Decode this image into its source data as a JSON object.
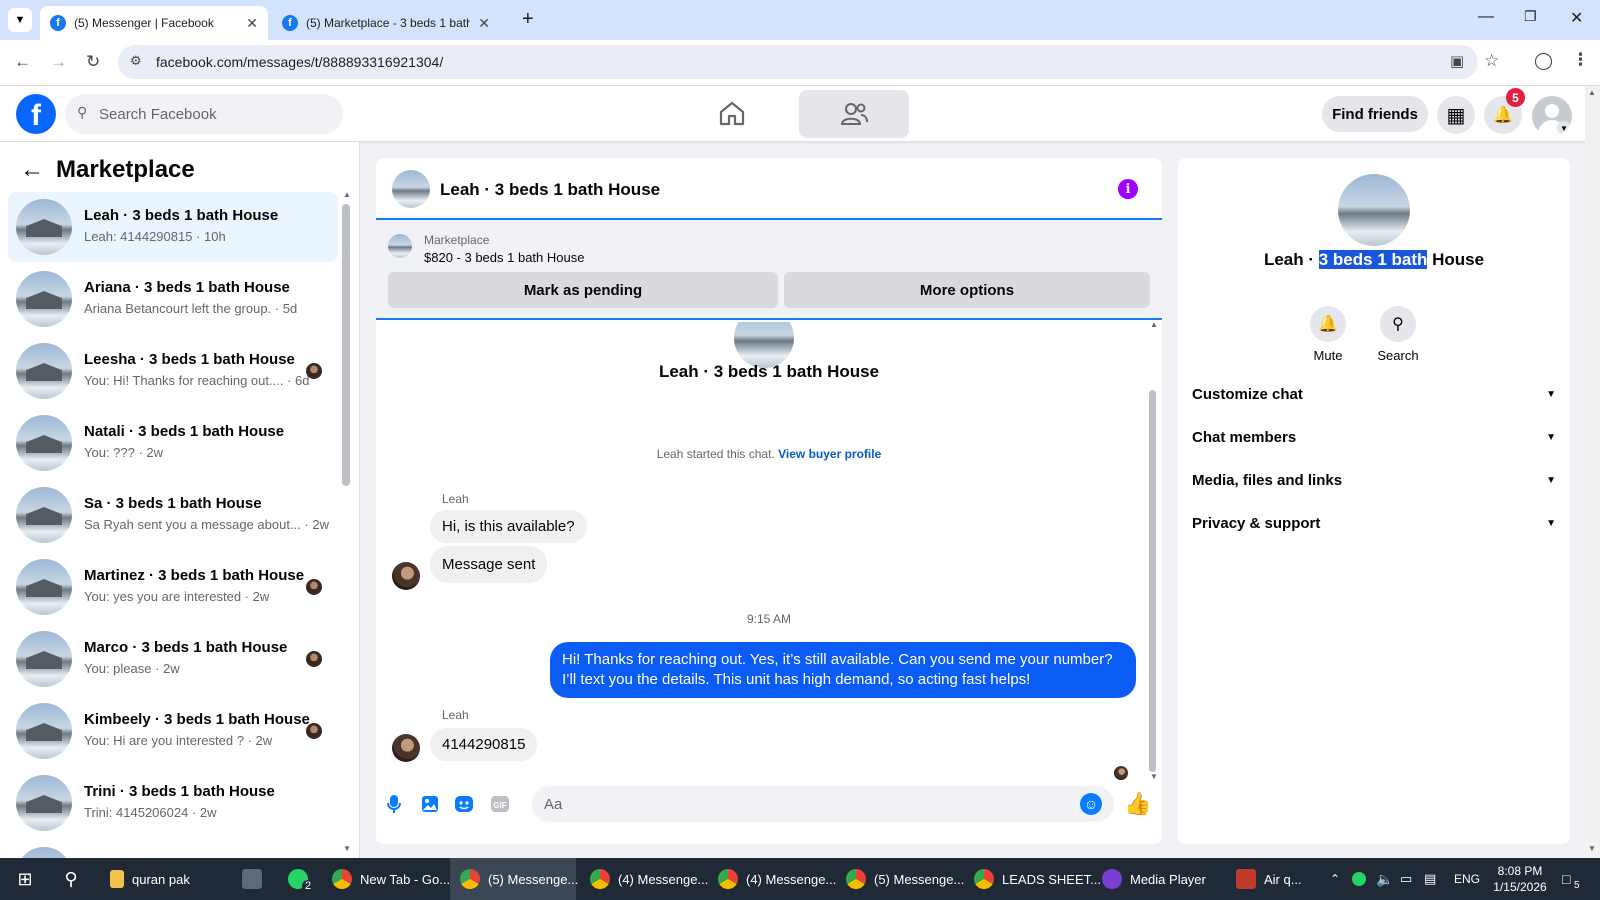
{
  "browser": {
    "tabs": [
      {
        "title": "(5) Messenger | Facebook",
        "active": true
      },
      {
        "title": "(5) Marketplace - 3 beds 1 bath",
        "active": false
      }
    ],
    "new_tab_symbol": "+",
    "url": "facebook.com/messages/t/888893316921304/"
  },
  "header": {
    "search_placeholder": "Search Facebook",
    "find_friends": "Find friends",
    "notification_count": "5",
    "colors": {
      "brand": "#0866ff",
      "badge": "#e41e3f"
    }
  },
  "sidebar": {
    "title": "Marketplace",
    "conversations": [
      {
        "name": "Leah · 3 beds 1 bath House",
        "preview": "Leah: 4144290815 · 10h",
        "selected": true,
        "read_avatar": false
      },
      {
        "name": "Ariana · 3 beds 1 bath House",
        "preview": "Ariana Betancourt left the group. · 5d",
        "selected": false,
        "read_avatar": false
      },
      {
        "name": "Leesha · 3 beds 1 bath House",
        "preview": "You: Hi! Thanks for reaching out.... · 6d",
        "selected": false,
        "read_avatar": true
      },
      {
        "name": "Natali · 3 beds 1 bath House",
        "preview": "You: ??? · 2w",
        "selected": false,
        "read_avatar": false
      },
      {
        "name": "Sa · 3 beds 1 bath House",
        "preview": "Sa Ryah sent you a message about... · 2w",
        "selected": false,
        "read_avatar": false
      },
      {
        "name": "Martinez · 3 beds 1 bath House",
        "preview": "You: yes you are interested · 2w",
        "selected": false,
        "read_avatar": true
      },
      {
        "name": "Marco · 3 beds 1 bath House",
        "preview": "You: please · 2w",
        "selected": false,
        "read_avatar": true
      },
      {
        "name": "Kimbeely · 3 beds 1 bath House",
        "preview": "You: Hi are you interested ? · 2w",
        "selected": false,
        "read_avatar": true
      },
      {
        "name": "Trini · 3 beds 1 bath House",
        "preview": "Trini: 4145206024 · 2w",
        "selected": false,
        "read_avatar": false
      }
    ]
  },
  "chat": {
    "title": "Leah · 3 beds 1 bath House",
    "listing": {
      "label": "Marketplace",
      "detail": "$820 - 3 beds 1 bath House",
      "mark_pending": "Mark as pending",
      "more_options": "More options"
    },
    "intro_name": "Leah · 3 beds 1 bath House",
    "started_text": "Leah started this chat.",
    "view_profile": "View buyer profile",
    "messages": {
      "sender1": "Leah",
      "m1": "Hi, is this available?",
      "m2": "Message sent",
      "time": "9:15 AM",
      "m3": "Hi! Thanks for reaching out. Yes, it’s still available. Can you send me your number? I’ll text you the details. This unit has high demand, so acting fast helps!",
      "sender2": "Leah",
      "m4": "4144290815"
    },
    "input_placeholder": "Aa",
    "accent": "#0a7cff",
    "my_bubble_color": "#0a5cf5"
  },
  "info_panel": {
    "name_before": "Leah · ",
    "name_selected": "3 beds 1 bath",
    "name_after": " House",
    "mute": "Mute",
    "search": "Search",
    "menu": [
      "Customize chat",
      "Chat members",
      "Media, files and links",
      "Privacy & support"
    ]
  },
  "taskbar": {
    "items": [
      {
        "label": "quran pak",
        "icon": "folder-icon",
        "active": false
      },
      {
        "label": "",
        "icon": "calculator-icon",
        "active": false
      },
      {
        "label": "",
        "icon": "whatsapp-icon",
        "active": false,
        "badge": "2"
      },
      {
        "label": "New Tab - Go...",
        "icon": "chrome-icon",
        "active": false
      },
      {
        "label": "(5) Messenge...",
        "icon": "chrome-icon",
        "active": true
      },
      {
        "label": "(4) Messenge...",
        "icon": "chrome-icon",
        "active": false
      },
      {
        "label": "(4) Messenge...",
        "icon": "chrome-icon",
        "active": false
      },
      {
        "label": "(5) Messenge...",
        "icon": "chrome-icon",
        "active": false
      },
      {
        "label": "LEADS SHEET...",
        "icon": "chrome-icon",
        "active": false
      },
      {
        "label": "Media Player",
        "icon": "media-player-icon",
        "active": false
      },
      {
        "label": "Air q...",
        "icon": "weather-icon",
        "active": false
      }
    ],
    "language": "ENG",
    "time": "8:08 PM",
    "date": "1/15/2026",
    "notif_count": "5"
  }
}
